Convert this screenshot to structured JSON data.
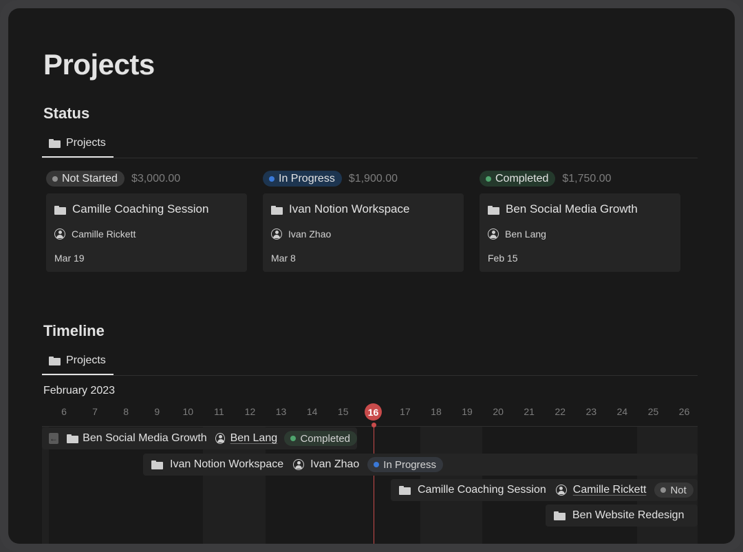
{
  "page_title": "Projects",
  "status_section": {
    "title": "Status",
    "tab_label": "Projects",
    "groups": [
      {
        "status": "Not Started",
        "amount": "$3,000.00",
        "color": "#8f8f8f",
        "pill_bg": "#373737",
        "card": {
          "title": "Camille Coaching Session",
          "person": "Camille Rickett",
          "date": "Mar 19"
        }
      },
      {
        "status": "In Progress",
        "amount": "$1,900.00",
        "color": "#3a79d8",
        "pill_bg": "#1d3550",
        "card": {
          "title": "Ivan Notion Workspace",
          "person": "Ivan Zhao",
          "date": "Mar 8"
        }
      },
      {
        "status": "Completed",
        "amount": "$1,750.00",
        "color": "#4fa46d",
        "pill_bg": "#24392c",
        "card": {
          "title": "Ben Social Media Growth",
          "person": "Ben Lang",
          "date": "Feb 15"
        }
      }
    ]
  },
  "timeline_section": {
    "title": "Timeline",
    "tab_label": "Projects",
    "month": "February 2023",
    "days": [
      "6",
      "7",
      "8",
      "9",
      "10",
      "11",
      "12",
      "13",
      "14",
      "15",
      "16",
      "17",
      "18",
      "19",
      "20",
      "21",
      "22",
      "23",
      "24",
      "25",
      "26"
    ],
    "today": "16",
    "bars": [
      {
        "title": "Ben Social Media Growth",
        "person": "Ben Lang",
        "status": "Completed",
        "status_color": "#4fa46d",
        "pill_bg": "#24392c",
        "back_icon": "arrow-left-icon"
      },
      {
        "title": "Ivan Notion Workspace",
        "person": "Ivan Zhao",
        "status": "In Progress",
        "status_color": "#3a79d8",
        "pill_bg": "#1d3550"
      },
      {
        "title": "Camille Coaching Session",
        "person": "Camille Rickett",
        "status": "Not",
        "status_color": "#8f8f8f",
        "pill_bg": "#373737"
      },
      {
        "title": "Ben Website Redesign"
      }
    ]
  }
}
